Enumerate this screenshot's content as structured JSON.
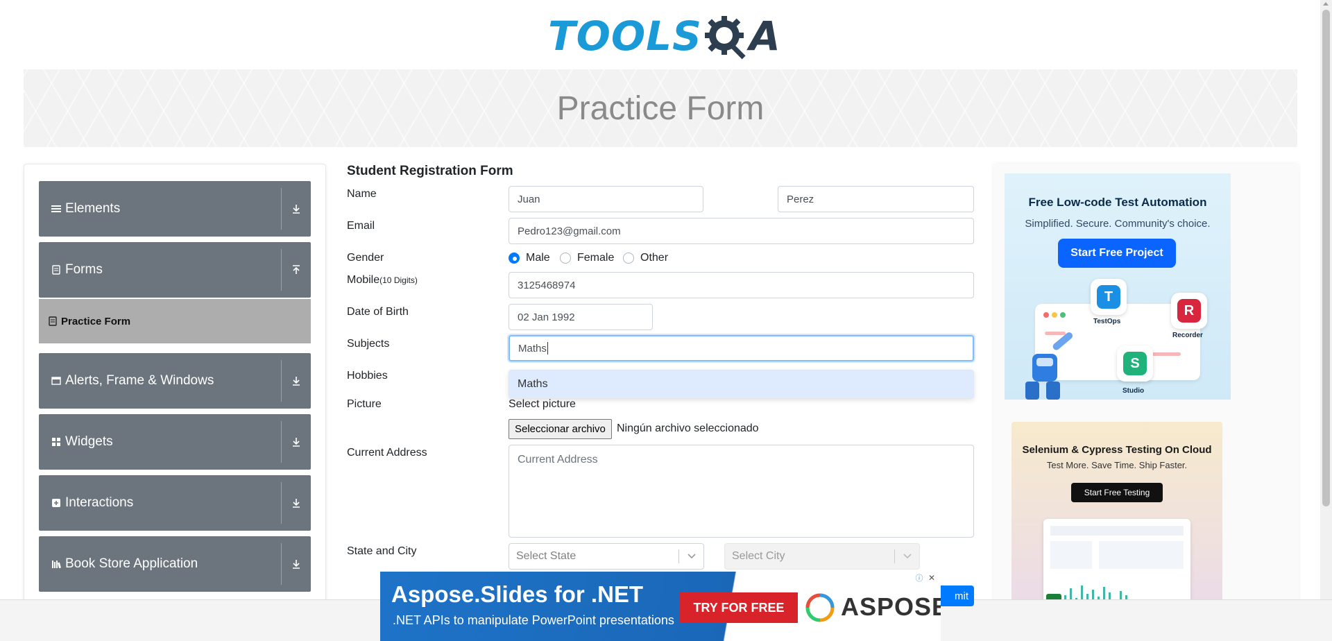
{
  "header": {
    "logo_text_left": "TOOLS",
    "logo_text_right": "A",
    "banner_title": "Practice Form"
  },
  "sidebar": {
    "groups": [
      {
        "label": "Elements",
        "icon": "hamburger-icon",
        "state": "collapsed"
      },
      {
        "label": "Forms",
        "icon": "document-icon",
        "state": "expanded"
      },
      {
        "label": "Alerts, Frame & Windows",
        "icon": "window-icon",
        "state": "collapsed"
      },
      {
        "label": "Widgets",
        "icon": "grid-icon",
        "state": "collapsed"
      },
      {
        "label": "Interactions",
        "icon": "cursor-icon",
        "state": "collapsed"
      },
      {
        "label": "Book Store Application",
        "icon": "books-icon",
        "state": "collapsed"
      }
    ],
    "active_item": {
      "label": "Practice Form",
      "icon": "file-icon"
    }
  },
  "form": {
    "title": "Student Registration Form",
    "labels": {
      "name": "Name",
      "email": "Email",
      "gender": "Gender",
      "mobile": "Mobile",
      "mobile_hint": "(10 Digits)",
      "dob": "Date of Birth",
      "subjects": "Subjects",
      "hobbies": "Hobbies",
      "picture": "Picture",
      "address": "Current Address",
      "state_city": "State and City"
    },
    "first_name": "Juan",
    "last_name": "Perez",
    "email": "Pedro123@gmail.com",
    "gender_options": [
      "Male",
      "Female",
      "Other"
    ],
    "gender_selected": "Male",
    "mobile": "3125468974",
    "dob": "02 Jan 1992",
    "subjects_input": "Maths",
    "subjects_suggestion": "Maths",
    "picture_label": "Select picture",
    "file_button": "Seleccionar archivo",
    "file_status": "Ningún archivo seleccionado",
    "address_placeholder": "Current Address",
    "state_placeholder": "Select State",
    "city_placeholder": "Select City",
    "submit_partial": "mit"
  },
  "ads": {
    "ad1": {
      "title": "Free Low-code Test Automation",
      "subtitle": "Simplified. Secure. Community's choice.",
      "button": "Start Free Project",
      "badges": [
        {
          "letter": "T",
          "label": "TestOps",
          "color": "#1a8fe3"
        },
        {
          "letter": "R",
          "label": "Recorder",
          "color": "#d7263d"
        },
        {
          "letter": "S",
          "label": "Studio",
          "color": "#1fb27a"
        }
      ]
    },
    "ad2": {
      "title": "Selenium & Cypress Testing On Cloud",
      "subtitle": "Test More. Save Time. Ship Faster.",
      "button": "Start Free Testing"
    },
    "bottom": {
      "headline": "Aspose.Slides for .NET",
      "subline": ".NET APIs to manipulate PowerPoint presentations",
      "cta": "TRY FOR FREE",
      "brand": "ASPOSE"
    }
  },
  "colors": {
    "logo_blue": "#1a9bd7",
    "sidebar_bg": "#6c757d",
    "active_item_bg": "#adadad",
    "radio_checked": "#007bff"
  }
}
